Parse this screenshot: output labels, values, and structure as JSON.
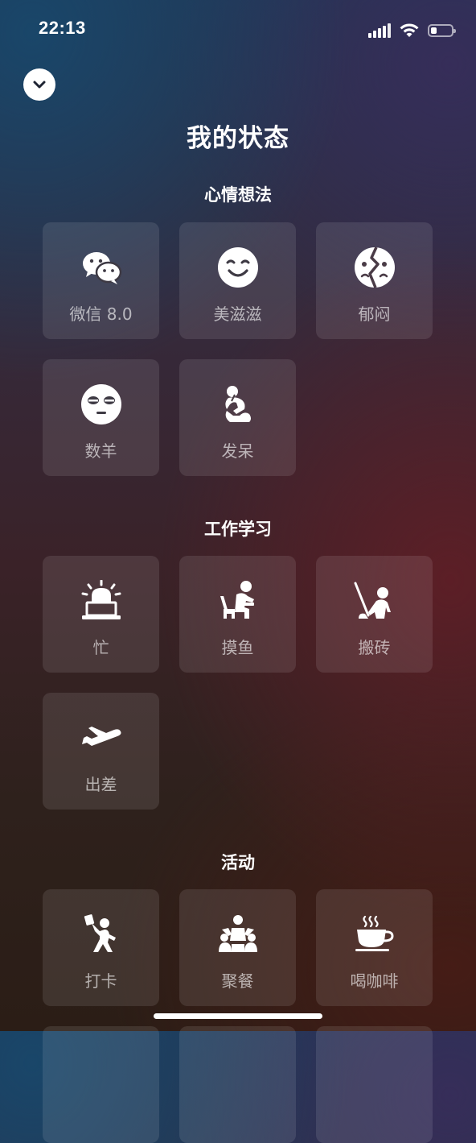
{
  "status_bar": {
    "time": "22:13",
    "battery_level": 0.3
  },
  "collapse_icon": "chevron-down-icon",
  "page_title": "我的状态",
  "sections": [
    {
      "title": "心情想法",
      "items": [
        {
          "label": "微信 8.0",
          "icon": "wechat-icon"
        },
        {
          "label": "美滋滋",
          "icon": "smile-face-icon"
        },
        {
          "label": "郁闷",
          "icon": "broken-face-icon"
        },
        {
          "label": "数羊",
          "icon": "sleepy-face-icon"
        },
        {
          "label": "发呆",
          "icon": "thinker-icon"
        }
      ]
    },
    {
      "title": "工作学习",
      "items": [
        {
          "label": "忙",
          "icon": "siren-laptop-icon"
        },
        {
          "label": "摸鱼",
          "icon": "slacking-person-icon"
        },
        {
          "label": "搬砖",
          "icon": "worker-icon"
        },
        {
          "label": "出差",
          "icon": "airplane-icon"
        }
      ]
    },
    {
      "title": "活动",
      "items": [
        {
          "label": "打卡",
          "icon": "check-in-person-icon"
        },
        {
          "label": "聚餐",
          "icon": "group-dinner-icon"
        },
        {
          "label": "喝咖啡",
          "icon": "coffee-cup-icon"
        }
      ]
    }
  ]
}
